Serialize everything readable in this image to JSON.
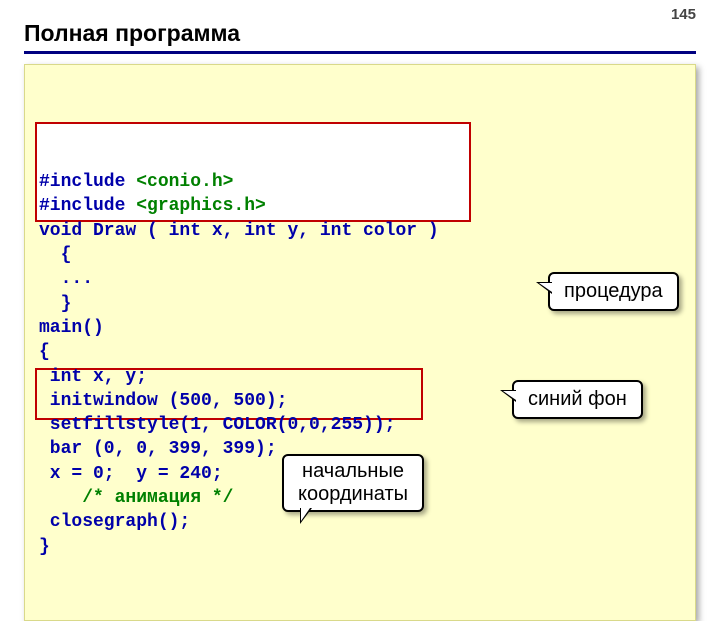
{
  "page_number": "145",
  "title": "Полная программа",
  "code": {
    "line1a": "#include ",
    "line1b": "<conio.h>",
    "line2a": "#include ",
    "line2b": "<graphics.h>",
    "line3": "void Draw ( int x, int y, int color )",
    "line4": "  {",
    "line5": "  ...",
    "line6": "  }",
    "line7": "main()",
    "line8": "{",
    "line9": " int x, y;",
    "line10": " initwindow (500, 500);",
    "line11": " setfillstyle(1, COLOR(0,0,255));",
    "line12": " bar (0, 0, 399, 399);",
    "line13": " x = 0;  y = 240;",
    "line14": "    /* анимация */",
    "line15": " closegraph();",
    "line16": "}"
  },
  "callouts": {
    "procedure": "процедура",
    "bluebg": "синий фон",
    "initcoords": "начальные\nкоординаты"
  }
}
